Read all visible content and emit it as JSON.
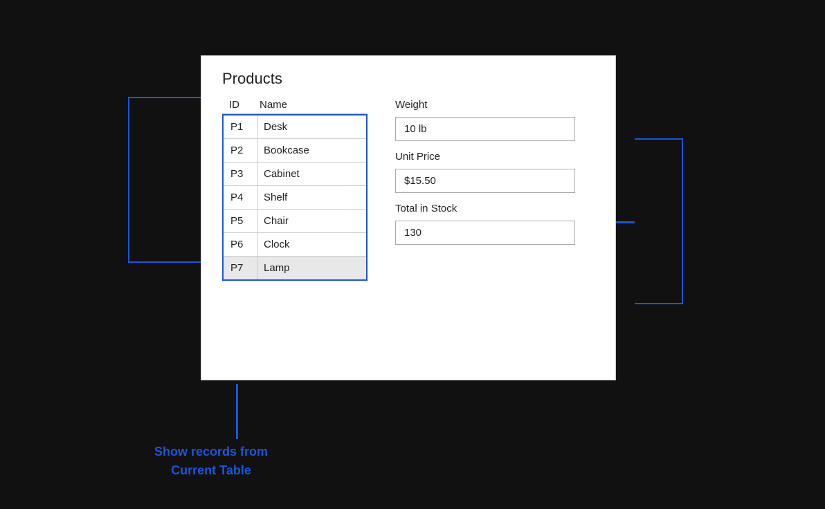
{
  "card": {
    "title": "Products",
    "table": {
      "columns": [
        "ID",
        "Name"
      ],
      "rows": [
        {
          "id": "P1",
          "name": "Desk",
          "highlighted": false
        },
        {
          "id": "P2",
          "name": "Bookcase",
          "highlighted": false
        },
        {
          "id": "P3",
          "name": "Cabinet",
          "highlighted": false
        },
        {
          "id": "P4",
          "name": "Shelf",
          "highlighted": false
        },
        {
          "id": "P5",
          "name": "Chair",
          "highlighted": false
        },
        {
          "id": "P6",
          "name": "Clock",
          "highlighted": false
        },
        {
          "id": "P7",
          "name": "Lamp",
          "highlighted": true
        }
      ]
    },
    "detail": {
      "weight_label": "Weight",
      "weight_value": "10 lb",
      "unit_price_label": "Unit Price",
      "unit_price_value": "$15.50",
      "total_stock_label": "Total in Stock",
      "total_stock_value": "130"
    }
  },
  "footer": {
    "show_records_line1": "Show records from",
    "show_records_line2": "Current Table"
  }
}
